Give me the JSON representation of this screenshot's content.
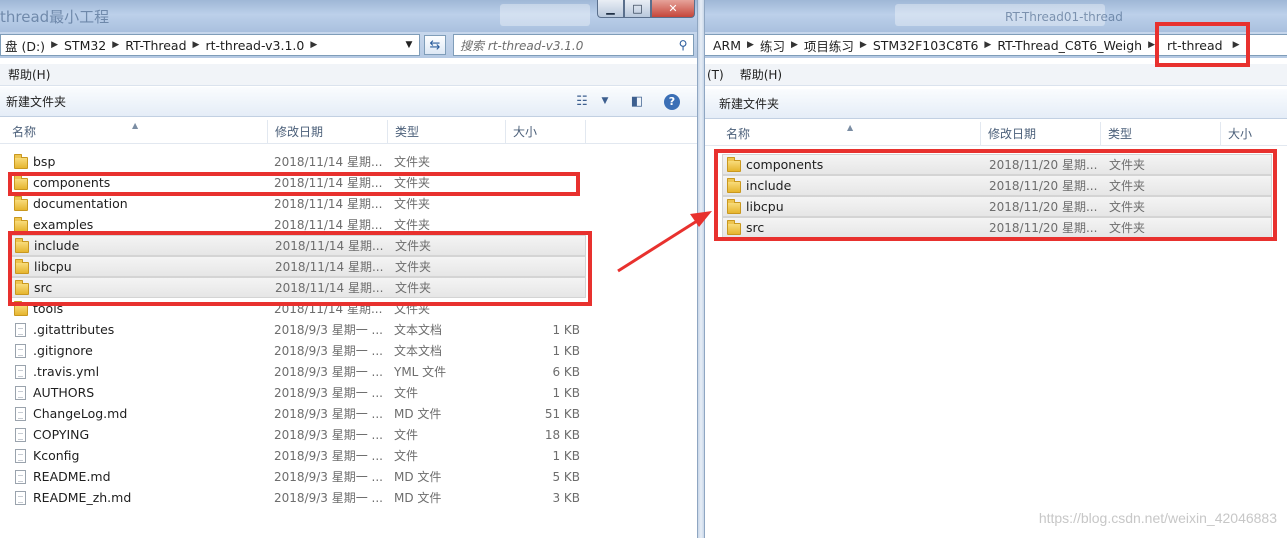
{
  "left": {
    "title": "thread最小工程",
    "address": [
      "盘 (D:)",
      "STM32",
      "RT-Thread",
      "rt-thread-v3.1.0"
    ],
    "search_placeholder": "搜索 rt-thread-v3.1.0",
    "menu": [
      "帮助(H)"
    ],
    "toolbar_new_folder": "新建文件夹",
    "columns": [
      "名称",
      "修改日期",
      "类型",
      "大小"
    ],
    "files": [
      {
        "name": "bsp",
        "date": "2018/11/14 星期...",
        "type": "文件夹",
        "size": "",
        "kind": "folder"
      },
      {
        "name": "components",
        "date": "2018/11/14 星期...",
        "type": "文件夹",
        "size": "",
        "kind": "folder"
      },
      {
        "name": "documentation",
        "date": "2018/11/14 星期...",
        "type": "文件夹",
        "size": "",
        "kind": "folder"
      },
      {
        "name": "examples",
        "date": "2018/11/14 星期...",
        "type": "文件夹",
        "size": "",
        "kind": "folder"
      },
      {
        "name": "include",
        "date": "2018/11/14 星期...",
        "type": "文件夹",
        "size": "",
        "kind": "folder"
      },
      {
        "name": "libcpu",
        "date": "2018/11/14 星期...",
        "type": "文件夹",
        "size": "",
        "kind": "folder"
      },
      {
        "name": "src",
        "date": "2018/11/14 星期...",
        "type": "文件夹",
        "size": "",
        "kind": "folder"
      },
      {
        "name": "tools",
        "date": "2018/11/14 星期...",
        "type": "文件夹",
        "size": "",
        "kind": "folder"
      },
      {
        "name": ".gitattributes",
        "date": "2018/9/3 星期一 ...",
        "type": "文本文档",
        "size": "1 KB",
        "kind": "file"
      },
      {
        "name": ".gitignore",
        "date": "2018/9/3 星期一 ...",
        "type": "文本文档",
        "size": "1 KB",
        "kind": "file"
      },
      {
        "name": ".travis.yml",
        "date": "2018/9/3 星期一 ...",
        "type": "YML 文件",
        "size": "6 KB",
        "kind": "file"
      },
      {
        "name": "AUTHORS",
        "date": "2018/9/3 星期一 ...",
        "type": "文件",
        "size": "1 KB",
        "kind": "file"
      },
      {
        "name": "ChangeLog.md",
        "date": "2018/9/3 星期一 ...",
        "type": "MD 文件",
        "size": "51 KB",
        "kind": "file"
      },
      {
        "name": "COPYING",
        "date": "2018/9/3 星期一 ...",
        "type": "文件",
        "size": "18 KB",
        "kind": "file"
      },
      {
        "name": "Kconfig",
        "date": "2018/9/3 星期一 ...",
        "type": "文件",
        "size": "1 KB",
        "kind": "file"
      },
      {
        "name": "README.md",
        "date": "2018/9/3 星期一 ...",
        "type": "MD 文件",
        "size": "5 KB",
        "kind": "file"
      },
      {
        "name": "README_zh.md",
        "date": "2018/9/3 星期一 ...",
        "type": "MD 文件",
        "size": "3 KB",
        "kind": "file"
      }
    ],
    "selected_rows": [
      4,
      5,
      6
    ]
  },
  "right": {
    "title": "RT-Thread01-thread",
    "address": [
      "ARM",
      "练习",
      "项目练习",
      "STM32F103C8T6",
      "RT-Thread_C8T6_Weigh",
      "rt-thread"
    ],
    "menu": [
      "(T)",
      "帮助(H)"
    ],
    "toolbar_new_folder": "新建文件夹",
    "columns": [
      "名称",
      "修改日期",
      "类型",
      "大小"
    ],
    "files": [
      {
        "name": "components",
        "date": "2018/11/20 星期...",
        "type": "文件夹",
        "size": "",
        "kind": "folder"
      },
      {
        "name": "include",
        "date": "2018/11/20 星期...",
        "type": "文件夹",
        "size": "",
        "kind": "folder"
      },
      {
        "name": "libcpu",
        "date": "2018/11/20 星期...",
        "type": "文件夹",
        "size": "",
        "kind": "folder"
      },
      {
        "name": "src",
        "date": "2018/11/20 星期...",
        "type": "文件夹",
        "size": "",
        "kind": "folder"
      }
    ],
    "selected_rows": [
      0,
      1,
      2,
      3
    ]
  },
  "window_controls": {
    "minimize": "▁",
    "maximize": "□",
    "close": "✕"
  },
  "watermark": "https://blog.csdn.net/weixin_42046883",
  "colors": {
    "highlight": "#e8312e",
    "accent": "#2a5c9c"
  },
  "icons": {
    "view": "view-options-icon",
    "preview": "preview-pane-icon",
    "help": "help-icon",
    "folder": "folder-icon",
    "file": "file-icon"
  }
}
